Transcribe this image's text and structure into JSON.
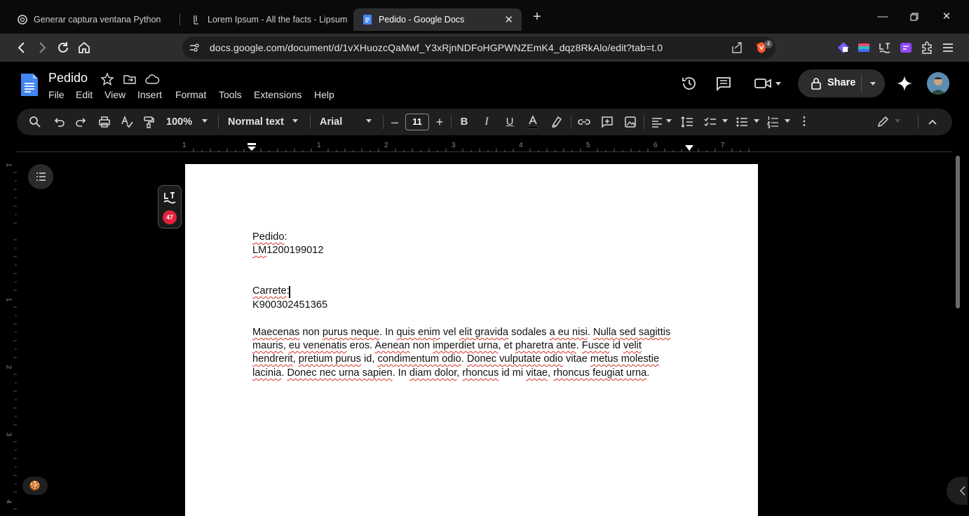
{
  "browser": {
    "tabs": [
      {
        "title": "Generar captura ventana Python",
        "icon": "chatgpt-icon",
        "active": false
      },
      {
        "title": "Lorem Ipsum - All the facts - Lipsum",
        "icon": "lipsum-icon",
        "active": false
      },
      {
        "title": "Pedido - Google Docs",
        "icon": "google-docs-icon",
        "active": true
      }
    ],
    "new_tab_label": "+",
    "url": "docs.google.com/document/d/1vXHuozcQaMwf_Y3xRjnNDFoHGPWNZEmK4_dqz8RkAlo/edit?tab=t.0",
    "brave_badge": "4"
  },
  "docs": {
    "title": "Pedido",
    "menus": [
      "File",
      "Edit",
      "View",
      "Insert",
      "Format",
      "Tools",
      "Extensions",
      "Help"
    ],
    "share_label": "Share",
    "toolbar": {
      "zoom": "100%",
      "style": "Normal text",
      "font": "Arial",
      "font_size": "11"
    },
    "ruler_h": [
      "1",
      "1",
      "2",
      "3",
      "4",
      "5",
      "6",
      "7"
    ],
    "ruler_v": [
      "1",
      "1",
      "2",
      "3",
      "4"
    ],
    "languagetool_count": "47",
    "emoji": "🍪"
  },
  "document": {
    "lines": [
      {
        "segments": [
          {
            "t": "Pedido",
            "err": true
          },
          {
            "t": ":",
            "err": false
          }
        ]
      },
      {
        "segments": [
          {
            "t": "LM",
            "err": true
          },
          {
            "t": "1200199012",
            "err": false
          }
        ]
      },
      {
        "segments": [
          {
            "t": "Carrete",
            "err": true
          },
          {
            "t": ":",
            "err": false
          }
        ]
      },
      {
        "segments": [
          {
            "t": "K900302451365",
            "err": false
          }
        ]
      },
      {
        "segments": [
          {
            "t": "Maecenas",
            "err": true
          },
          {
            "t": " non ",
            "err": false
          },
          {
            "t": "purus neque",
            "err": true
          },
          {
            "t": ". In ",
            "err": false
          },
          {
            "t": "quis enim",
            "err": true
          },
          {
            "t": " vel ",
            "err": false
          },
          {
            "t": "elit gravida",
            "err": true
          },
          {
            "t": " sodales ",
            "err": false
          },
          {
            "t": "a eu nisi",
            "err": true
          },
          {
            "t": ". ",
            "err": false
          },
          {
            "t": "Nulla sed sagittis",
            "err": true
          }
        ]
      },
      {
        "segments": [
          {
            "t": "mauris",
            "err": true
          },
          {
            "t": ", ",
            "err": false
          },
          {
            "t": "eu venenatis",
            "err": true
          },
          {
            "t": " eros. ",
            "err": false
          },
          {
            "t": "Aenean",
            "err": true
          },
          {
            "t": " non ",
            "err": false
          },
          {
            "t": "imperdiet urna",
            "err": true
          },
          {
            "t": ", et ",
            "err": false
          },
          {
            "t": "pharetra ante",
            "err": true
          },
          {
            "t": ". ",
            "err": false
          },
          {
            "t": "Fusce",
            "err": true
          },
          {
            "t": " id ",
            "err": false
          },
          {
            "t": "velit",
            "err": true
          }
        ]
      },
      {
        "segments": [
          {
            "t": "hendrerit",
            "err": true
          },
          {
            "t": ", ",
            "err": false
          },
          {
            "t": "pretium purus",
            "err": true
          },
          {
            "t": " id, ",
            "err": false
          },
          {
            "t": "condimentum odio",
            "err": true
          },
          {
            "t": ". ",
            "err": false
          },
          {
            "t": "Donec vulputate odio",
            "err": true
          },
          {
            "t": " vitae ",
            "err": false
          },
          {
            "t": "metus molestie",
            "err": true
          }
        ]
      },
      {
        "segments": [
          {
            "t": "lacinia",
            "err": true
          },
          {
            "t": ". ",
            "err": false
          },
          {
            "t": "Donec nec urna sapien",
            "err": true
          },
          {
            "t": ". In ",
            "err": false
          },
          {
            "t": "diam dolor",
            "err": true
          },
          {
            "t": ", ",
            "err": false
          },
          {
            "t": "rhoncus",
            "err": true
          },
          {
            "t": " id mi ",
            "err": false
          },
          {
            "t": "vitae",
            "err": true
          },
          {
            "t": ", ",
            "err": false
          },
          {
            "t": "rhoncus feugiat urna",
            "err": true
          },
          {
            "t": ".",
            "err": false
          }
        ]
      }
    ]
  }
}
